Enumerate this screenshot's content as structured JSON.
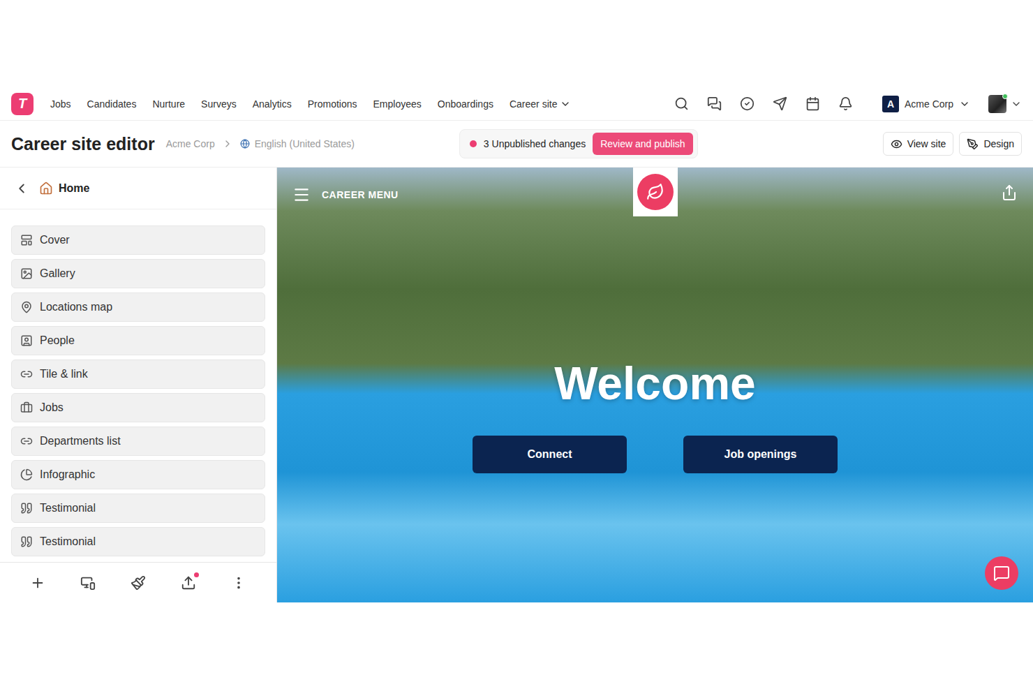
{
  "logo": "T",
  "nav": {
    "items": [
      {
        "label": "Jobs",
        "dropdown": false
      },
      {
        "label": "Candidates",
        "dropdown": false
      },
      {
        "label": "Nurture",
        "dropdown": false
      },
      {
        "label": "Surveys",
        "dropdown": false
      },
      {
        "label": "Analytics",
        "dropdown": false
      },
      {
        "label": "Promotions",
        "dropdown": false
      },
      {
        "label": "Employees",
        "dropdown": false
      },
      {
        "label": "Onboardings",
        "dropdown": false
      },
      {
        "label": "Career site",
        "dropdown": true
      }
    ],
    "company": {
      "initial": "A",
      "name": "Acme Corp"
    },
    "user": {
      "online": true
    }
  },
  "header": {
    "title": "Career site editor",
    "org": "Acme Corp",
    "language": "English (United States)",
    "changes": "3 Unpublished changes",
    "publish": "Review and publish",
    "actions": [
      {
        "label": "View site",
        "kind": "view"
      },
      {
        "label": "Design",
        "kind": "design"
      }
    ]
  },
  "sidebar": {
    "page": "Home",
    "sections": [
      {
        "label": "Cover",
        "kind": "cover"
      },
      {
        "label": "Gallery",
        "kind": "gallery"
      },
      {
        "label": "Locations map",
        "kind": "map"
      },
      {
        "label": "People",
        "kind": "people"
      },
      {
        "label": "Tile & link",
        "kind": "link"
      },
      {
        "label": "Jobs",
        "kind": "jobs"
      },
      {
        "label": "Departments list",
        "kind": "link"
      },
      {
        "label": "Infographic",
        "kind": "infographic"
      },
      {
        "label": "Testimonial",
        "kind": "testimonial"
      },
      {
        "label": "Testimonial",
        "kind": "testimonial"
      }
    ],
    "publishBadge": true
  },
  "preview": {
    "menu": "CAREER MENU",
    "heading": "Welcome",
    "buttons": [
      "Connect",
      "Job openings"
    ]
  }
}
